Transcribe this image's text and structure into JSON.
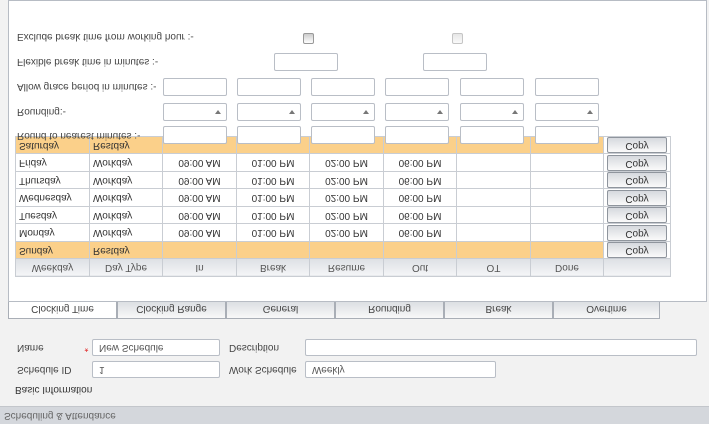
{
  "window": {
    "title": "Scheduling & Attendance"
  },
  "basic": {
    "section_title": "Basic Information",
    "schedule_id_label": "Schedule ID",
    "schedule_id_value": "1",
    "name_label": "Name",
    "name_value": "New Schedule",
    "work_schedule_label": "Work Schedule",
    "work_schedule_value": "Weekly",
    "description_label": "Description",
    "description_value": "",
    "required_mark": "*"
  },
  "tabs": [
    "Clocking Time",
    "Clocking Range",
    "General",
    "Rounding",
    "Break",
    "Overtime"
  ],
  "grid": {
    "headers": [
      "Weekday",
      "Day Type",
      "In",
      "Break",
      "Resume",
      "Out",
      "OT",
      "Done",
      ""
    ],
    "copy_label": "Copy",
    "rows": [
      {
        "weekday": "Sunday",
        "daytype": "Restday",
        "in": "",
        "brk": "",
        "resume": "",
        "out": "",
        "ot": "",
        "done": ""
      },
      {
        "weekday": "Monday",
        "daytype": "Workday",
        "in": "09:00 AM",
        "brk": "01:00 PM",
        "resume": "02:00 PM",
        "out": "06:00 PM",
        "ot": "",
        "done": ""
      },
      {
        "weekday": "Tuesday",
        "daytype": "Workday",
        "in": "09:00 AM",
        "brk": "01:00 PM",
        "resume": "02:00 PM",
        "out": "06:00 PM",
        "ot": "",
        "done": ""
      },
      {
        "weekday": "Wednesday",
        "daytype": "Workday",
        "in": "09:00 AM",
        "brk": "01:00 PM",
        "resume": "02:00 PM",
        "out": "06:00 PM",
        "ot": "",
        "done": ""
      },
      {
        "weekday": "Thursday",
        "daytype": "Workday",
        "in": "09:00 AM",
        "brk": "01:00 PM",
        "resume": "02:00 PM",
        "out": "06:00 PM",
        "ot": "",
        "done": ""
      },
      {
        "weekday": "Friday",
        "daytype": "Workday",
        "in": "09:00 AM",
        "brk": "01:00 PM",
        "resume": "02:00 PM",
        "out": "06:00 PM",
        "ot": "",
        "done": ""
      },
      {
        "weekday": "Saturday",
        "daytype": "Restday",
        "in": "",
        "brk": "",
        "resume": "",
        "out": "",
        "ot": "",
        "done": ""
      }
    ]
  },
  "options": {
    "round_label": "Round to nearest minutes :-",
    "rounding_label": "Rounding:-",
    "grace_label": "Allow grace period in minutes :-",
    "flexible_label": "Flexible break time in minutes :-",
    "exclude_label": "Exclude break time from working hour :-"
  },
  "colors": {
    "restday": "#fbd08a",
    "header_bar": "#d4d7dc",
    "required": "#e02020"
  }
}
